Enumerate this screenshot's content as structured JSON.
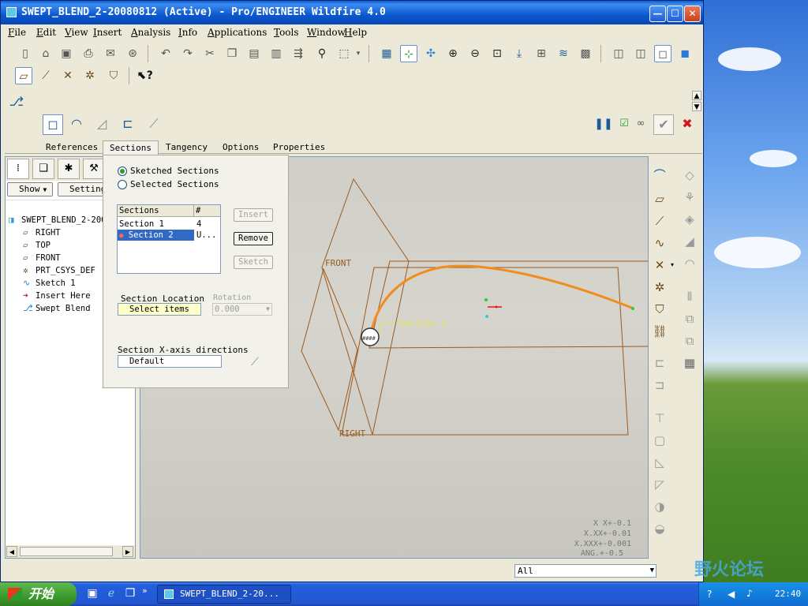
{
  "window": {
    "title": "SWEPT_BLEND_2-20080812 (Active) - Pro/ENGINEER Wildfire 4.0",
    "min_glyph": "—",
    "max_glyph": "☐",
    "close_glyph": "✕"
  },
  "menu": {
    "file": "ile",
    "file_key": "F",
    "edit": "dit",
    "edit_key": "E",
    "view": "iew",
    "view_key": "V",
    "insert": "nsert",
    "insert_key": "I",
    "analysis": "nalysis",
    "analysis_key": "A",
    "info": "nfo",
    "info_key": "I",
    "applications": "pplications",
    "applications_key": "A",
    "tools": "ools",
    "tools_key": "T",
    "window": "indow",
    "window_key": "W",
    "help": "elp",
    "help_key": "H"
  },
  "dashboard": {
    "tabs": [
      "References",
      "Sections",
      "Tangency",
      "Options",
      "Properties"
    ],
    "selected_tab": "Sections"
  },
  "sections_panel": {
    "radio_sketched": "Sketched Sections",
    "radio_selected": "Selected Sections",
    "table_header_sections": "Sections",
    "table_header_count": "#",
    "rows": [
      {
        "name": "Section 1",
        "count": "4"
      },
      {
        "name": "Section 2",
        "count": "U..."
      }
    ],
    "btn_insert": "Insert",
    "btn_remove": "Remove",
    "btn_sketch": "Sketch",
    "location_label": "Section Location",
    "location_value": "Select items",
    "rotation_label": "Rotation",
    "rotation_value": "0.000",
    "xaxis_label": "Section X-axis directions",
    "xaxis_value": "Default"
  },
  "model_tree": {
    "show_label": "Show",
    "settings_label": "Setting",
    "root": "SWEPT_BLEND_2-200",
    "items": [
      "RIGHT",
      "TOP",
      "FRONT",
      "PRT_CSYS_DEF",
      "Sketch 1",
      "Insert Here",
      "Swept Blend"
    ]
  },
  "graphics": {
    "label_front": "FRONT",
    "label_right": "RIGHT",
    "label_section": "Section 1",
    "marker_text": "####",
    "tol_x": "X X+-0.1",
    "tol_xx": "X.XX+-0.01",
    "tol_xxx": "X.XXX+-0.001",
    "tol_ang": "ANG.+-0.5"
  },
  "status": {
    "filter": "All"
  },
  "taskbar": {
    "start": "开始",
    "task": "SWEPT_BLEND_2-20...",
    "clock": "22:40",
    "watermark": "野火论坛",
    "chevron": "»"
  },
  "colors": {
    "sweep_curve": "#f28c1c",
    "datum_edge": "#9b5a1e",
    "selection_blue": "#316ac5",
    "xp_title": "#0b58d0"
  }
}
